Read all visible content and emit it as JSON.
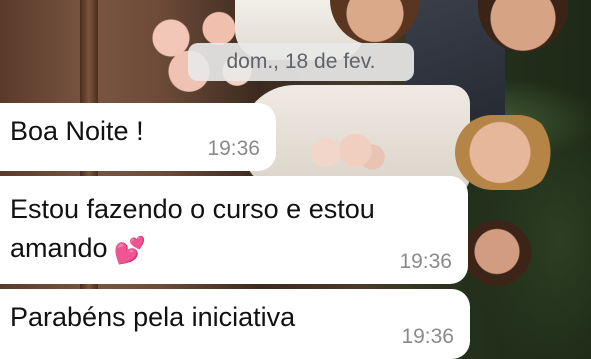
{
  "chat": {
    "date_separator": "dom., 18 de fev.",
    "messages": [
      {
        "text": "Boa Noite !",
        "time": "19:36"
      },
      {
        "text_line1": "Estou fazendo o curso e estou",
        "text_line2": "amando",
        "emoji": "two-hearts-icon",
        "time": "19:36"
      },
      {
        "text": "Parabéns pela iniciativa",
        "time": "19:36"
      }
    ]
  },
  "colors": {
    "bubble": "#ffffff",
    "date_pill": "#e8e8e8",
    "timestamp": "#8a8a8a",
    "heart": "#ff3fa5"
  }
}
